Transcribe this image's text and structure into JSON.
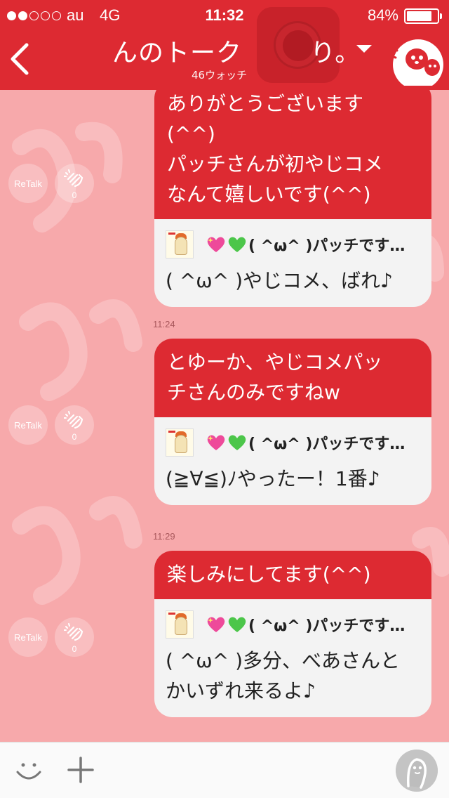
{
  "status": {
    "carrier": "au",
    "network": "4G",
    "time": "11:32",
    "battery": "84%",
    "battery_level": 0.84,
    "signal_bars_on": 2,
    "signal_bars_total": 5
  },
  "header": {
    "title": "んのトーク",
    "title_extra": "り。",
    "watchers": "46ウォッチ",
    "accent_color": "#dd2a32"
  },
  "messages": [
    {
      "timestamp": "",
      "text": "ありがとうございます\n(^^)\nパッチさんが初やじコメ\nなんて嬉しいです(^^)",
      "quote_author": "( ^ω^ )パッチです…",
      "quote_text": "( ^ω^ )やじコメ、ばれ♪",
      "retalk_label": "ReTalk",
      "clap_count": "0"
    },
    {
      "timestamp": "11:24",
      "text": "とゆーか、やじコメパッ\nチさんのみですねw",
      "quote_author": "( ^ω^ )パッチです…",
      "quote_text": "(≧∀≦)ﾉやったー！1番♪",
      "retalk_label": "ReTalk",
      "clap_count": "0"
    },
    {
      "timestamp": "11:29",
      "text": "楽しみにしてます(^^)",
      "quote_author": "( ^ω^ )パッチです…",
      "quote_text": "( ^ω^ )多分、べあさんと\nかいずれ来るよ♪",
      "retalk_label": "ReTalk",
      "clap_count": "0"
    }
  ],
  "icons": {
    "back": "chevron-left-icon",
    "record": "record-icon",
    "dropdown": "caret-down-icon",
    "ghost": "ghost-mascot-icon",
    "clap": "clap-icon",
    "smile": "smile-icon",
    "plus": "plus-icon",
    "profile": "profile-icon"
  }
}
